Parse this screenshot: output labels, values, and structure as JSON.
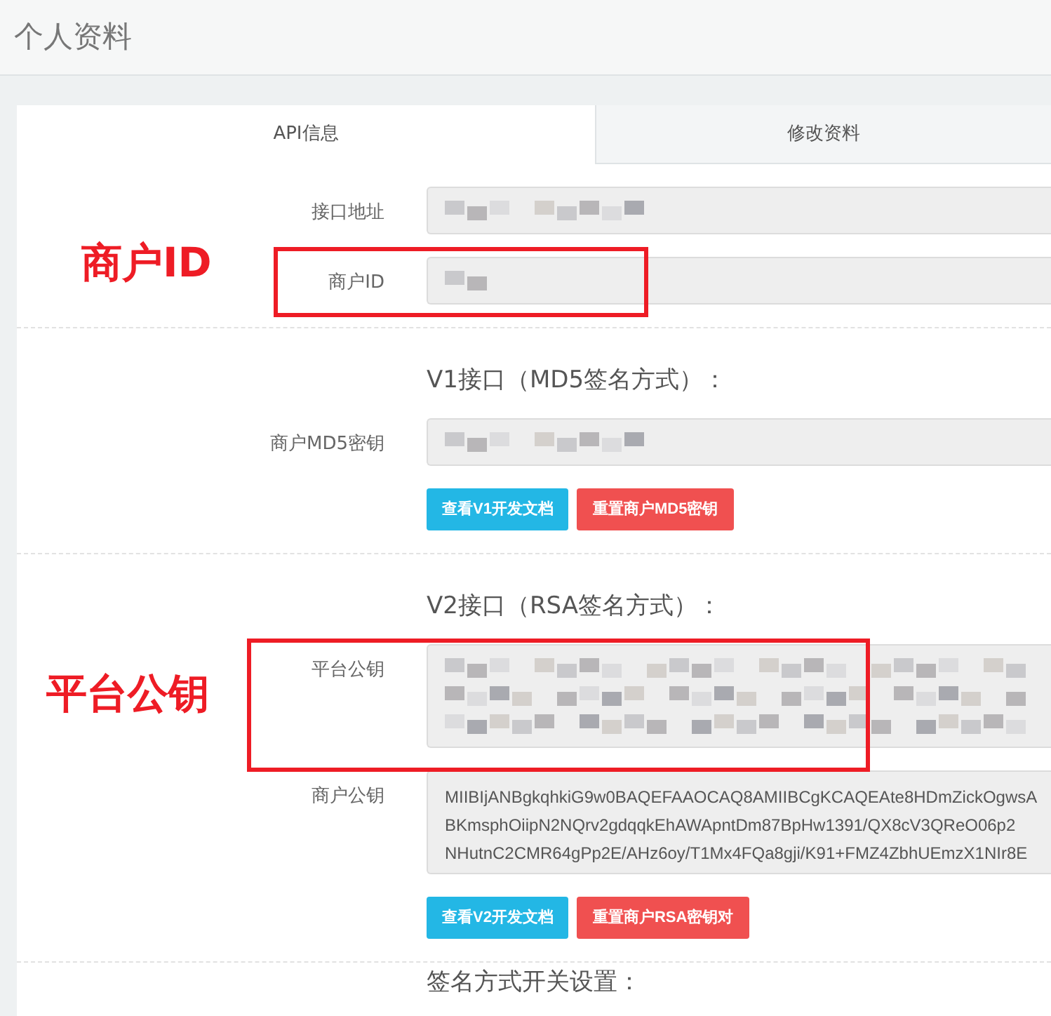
{
  "page_title": "个人资料",
  "tabs": [
    {
      "label": "API信息",
      "selected": true
    },
    {
      "label": "修改资料",
      "selected": false
    }
  ],
  "groups": [
    {
      "fields": [
        {
          "label": "接口地址",
          "kind": "redacted"
        },
        {
          "label": "商户ID",
          "kind": "redacted_short"
        }
      ]
    },
    {
      "heading": "V1接口（MD5签名方式）：",
      "fields": [
        {
          "label": "商户MD5密钥",
          "kind": "redacted"
        }
      ],
      "buttons": [
        {
          "label": "查看V1开发文档",
          "kind": "info"
        },
        {
          "label": "重置商户MD5密钥",
          "kind": "danger"
        }
      ]
    },
    {
      "heading": "V2接口（RSA签名方式）：",
      "fields": [
        {
          "label": "平台公钥",
          "kind": "redacted_multiline"
        },
        {
          "label": "商户公钥",
          "kind": "text",
          "lines": [
            "MIIBIjANBgkqhkiG9w0BAQEFAAOCAQ8AMIIBCgKCAQEAte8HDmZickOgwsA",
            "BKmsphOiipN2NQrv2gdqqkEhAWApntDm87BpHw1391/QX8cV3QReO06p2",
            "NHutnC2CMR64gPp2E/AHz6oy/T1Mx4FQa8gji/K91+FMZ4ZbhUEmzX1NIr8E"
          ]
        }
      ],
      "buttons": [
        {
          "label": "查看V2开发文档",
          "kind": "info"
        },
        {
          "label": "重置商户RSA密钥对",
          "kind": "danger"
        }
      ]
    },
    {
      "heading": "签名方式开关设置："
    }
  ],
  "annotations": [
    {
      "text": "商户ID"
    },
    {
      "text": "平台公钥"
    }
  ]
}
